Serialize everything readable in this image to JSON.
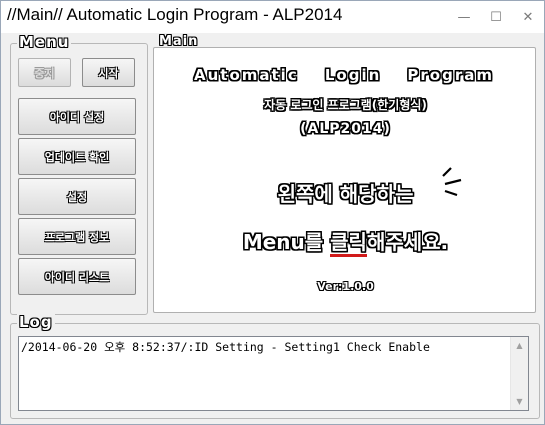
{
  "window": {
    "title": "//Main// Automatic Login Program - ALP2014",
    "minimize_glyph": "—",
    "maximize_glyph": "☐",
    "close_glyph": "✕"
  },
  "menu": {
    "group_label": "Menu",
    "stop_label": "중지",
    "start_label": "시작",
    "items": [
      "아이디 설정",
      "업데이트 확인",
      "설정",
      "프로그램 정보",
      "아이디 리스트"
    ]
  },
  "main": {
    "group_label": "Main",
    "heading_words": [
      "Automatic",
      "Login",
      "Program"
    ],
    "subtitle_kr": "자동 로그인 프로그램(한기형식)",
    "subtitle_code": "(ALP2014)",
    "instruction_line1": "왼쪽에 해당하는",
    "instruction_line2_a": "Menu를 ",
    "instruction_line2_b": "클릭",
    "instruction_line2_c": "해주세요.",
    "version": "Ver:1.0.0",
    "underline_color": "#d11a1a"
  },
  "log": {
    "group_label": "Log",
    "entries": [
      "/2014-06-20 오후 8:52:37/:ID Setting - Setting1 Check Enable"
    ]
  }
}
